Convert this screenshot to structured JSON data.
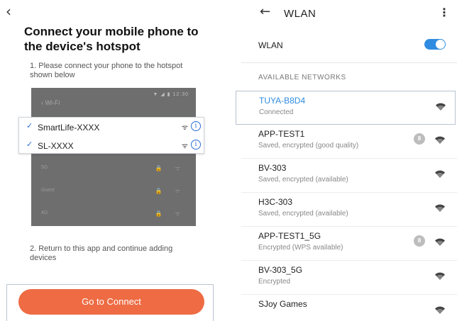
{
  "left": {
    "back_icon": "chevron-left-icon",
    "back_glyph": "‹",
    "title": "Connect your mobile phone to the device's hotspot",
    "step1": "1. Please connect your phone to the hotspot shown below",
    "mock": {
      "status": "▼ ◢ ▮ 12:30",
      "title": "‹  Wi-Fi",
      "rows": [
        {
          "name": "5G",
          "icons": "🔒 ᯤ"
        },
        {
          "name": "Guest",
          "icons": "🔒 ᯤ"
        },
        {
          "name": "4G",
          "icons": "🔒 ᯤ"
        }
      ]
    },
    "popup": {
      "check_glyph": "✓",
      "wifi_glyph": "ᯤ",
      "info_glyph": "i",
      "items": [
        {
          "name": "SmartLife-XXXX"
        },
        {
          "name": "SL-XXXX"
        }
      ]
    },
    "step2": "2. Return to this app and continue adding devices",
    "connect_button": "Go to Connect",
    "accent_color": "#ee6b43",
    "link_color": "#2c6fd6"
  },
  "right": {
    "back_glyph": "←",
    "title": "WLAN",
    "menu_glyph": "⋮",
    "wlan_label": "WLAN",
    "wlan_enabled": true,
    "section_title": "AVAILABLE NETWORKS",
    "accent_color": "#2f8ce0",
    "networks": [
      {
        "name": "TUYA-B8D4",
        "status": "Connected",
        "wps": false,
        "selected": true,
        "signal": "full"
      },
      {
        "name": "APP-TEST1",
        "status": "Saved, encrypted (good quality)",
        "wps": true,
        "selected": false,
        "signal": "full"
      },
      {
        "name": "BV-303",
        "status": "Saved, encrypted (available)",
        "wps": false,
        "selected": false,
        "signal": "full"
      },
      {
        "name": "H3C-303",
        "status": "Saved, encrypted (available)",
        "wps": false,
        "selected": false,
        "signal": "full"
      },
      {
        "name": "APP-TEST1_5G",
        "status": "Encrypted (WPS available)",
        "wps": true,
        "selected": false,
        "signal": "full"
      },
      {
        "name": "BV-303_5G",
        "status": "Encrypted",
        "wps": false,
        "selected": false,
        "signal": "full"
      },
      {
        "name": "SJoy Games",
        "status": "",
        "wps": false,
        "selected": false,
        "signal": "full"
      }
    ]
  }
}
